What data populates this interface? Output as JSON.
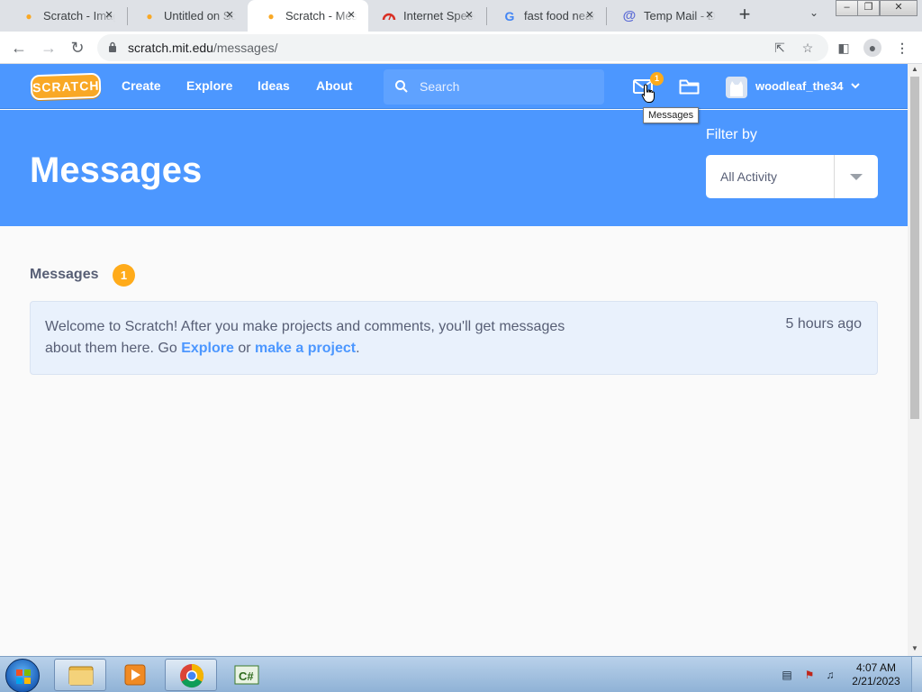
{
  "tabs": [
    {
      "title": "Scratch - Imagine, Program, Share",
      "icon": "scratch-cat-icon"
    },
    {
      "title": "Untitled on Scratch",
      "icon": "scratch-cat-icon"
    },
    {
      "title": "Scratch - Messages",
      "icon": "scratch-cat-icon",
      "active": true
    },
    {
      "title": "Internet Speed Test",
      "icon": "speedometer-icon"
    },
    {
      "title": "fast food near me",
      "icon": "google-icon"
    },
    {
      "title": "Temp Mail - Disposable",
      "icon": "at-sign-icon"
    }
  ],
  "window_controls": {
    "minimize": "‒",
    "restore": "❐",
    "close": "✕"
  },
  "address": {
    "domain": "scratch.mit.edu",
    "path": "/messages/"
  },
  "scratch_nav": {
    "logo": "SCRATCH",
    "links": [
      "Create",
      "Explore",
      "Ideas",
      "About"
    ],
    "search_placeholder": "Search",
    "messages_badge": "1",
    "username": "woodleaf_the34"
  },
  "tooltip": "Messages",
  "hero": {
    "title": "Messages",
    "filter_label": "Filter by",
    "filter_value": "All Activity"
  },
  "messages": {
    "heading": "Messages",
    "count": "1",
    "items": [
      {
        "text_before": "Welcome to Scratch! After you make projects and comments, you'll get messages about them here. Go ",
        "link1": "Explore",
        "middle": " or ",
        "link2": "make a project",
        "end": ".",
        "time": "5 hours ago"
      }
    ]
  },
  "taskbar": {
    "apps": [
      "explorer-icon",
      "media-player-icon",
      "chrome-icon",
      "csharp-icon"
    ],
    "time": "4:07 AM",
    "date": "2/21/2023"
  },
  "colors": {
    "scratch_blue": "#4c97ff",
    "badge_orange": "#ffab1a",
    "card_bg": "#e9f1fc"
  }
}
